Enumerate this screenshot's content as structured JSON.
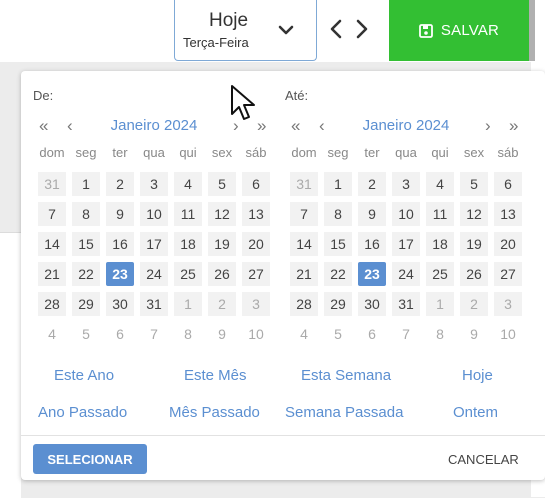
{
  "header": {
    "date_title": "Hoje",
    "date_subtitle": "Terça-Feira",
    "save_label": "SALVAR",
    "colors": {
      "save": "#33bf33",
      "accent": "#5b8fd1"
    }
  },
  "picker": {
    "from_label": "De:",
    "to_label": "Até:",
    "calendars": [
      {
        "month_label": "Janeiro 2024",
        "weekdays": [
          "dom",
          "seg",
          "ter",
          "qua",
          "qui",
          "sex",
          "sáb"
        ],
        "days": [
          "31",
          "1",
          "2",
          "3",
          "4",
          "5",
          "6",
          "7",
          "8",
          "9",
          "10",
          "11",
          "12",
          "13",
          "14",
          "15",
          "16",
          "17",
          "18",
          "19",
          "20",
          "21",
          "22",
          "23",
          "24",
          "25",
          "26",
          "27",
          "28",
          "29",
          "30",
          "31",
          "1",
          "2",
          "3",
          "4",
          "5",
          "6",
          "7",
          "8",
          "9",
          "10"
        ],
        "selected_day": "23"
      },
      {
        "month_label": "Janeiro 2024",
        "weekdays": [
          "dom",
          "seg",
          "ter",
          "qua",
          "qui",
          "sex",
          "sáb"
        ],
        "days": [
          "31",
          "1",
          "2",
          "3",
          "4",
          "5",
          "6",
          "7",
          "8",
          "9",
          "10",
          "11",
          "12",
          "13",
          "14",
          "15",
          "16",
          "17",
          "18",
          "19",
          "20",
          "21",
          "22",
          "23",
          "24",
          "25",
          "26",
          "27",
          "28",
          "29",
          "30",
          "31",
          "1",
          "2",
          "3",
          "4",
          "5",
          "6",
          "7",
          "8",
          "9",
          "10"
        ],
        "selected_day": "23"
      }
    ],
    "shortcuts": [
      "Este Ano",
      "Este Mês",
      "Esta Semana",
      "Hoje",
      "Ano Passado",
      "Mês Passado",
      "Semana Passada",
      "Ontem"
    ],
    "select_label": "SELECIONAR",
    "cancel_label": "CANCELAR"
  }
}
